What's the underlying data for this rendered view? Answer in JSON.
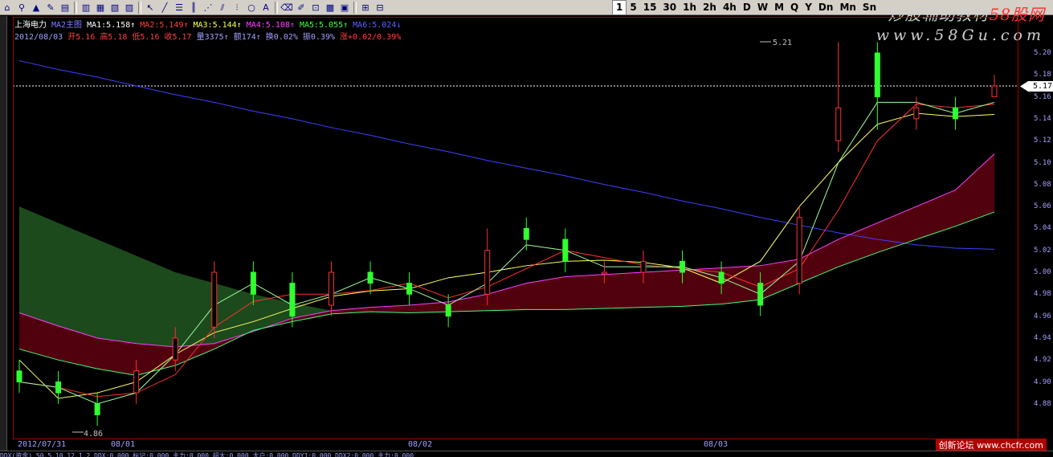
{
  "toolbar": {
    "icons": [
      "home-icon",
      "search-icon",
      "alarm-icon",
      "draw-icon",
      "layout-1-icon",
      "layout-2-icon",
      "layout-3-icon",
      "layout-4-icon",
      "layout-5-icon",
      "cursor-icon",
      "line-tool-icon",
      "text-tool-icon",
      "bar-tool-icon",
      "fan-tool-icon",
      "channel-tool-icon",
      "cycle-tool-icon",
      "shape-tool-icon",
      "text-label-icon",
      "erase-icon",
      "brush-icon",
      "lock-icon",
      "color-icon",
      "save-icon",
      "indicator-icon",
      "grid-icon"
    ],
    "periods": [
      "1",
      "5",
      "15",
      "30",
      "1h",
      "2h",
      "4h",
      "D",
      "W",
      "M",
      "Q",
      "Y",
      "Dn",
      "Mn",
      "Sn"
    ],
    "active_period": "1"
  },
  "watermark": {
    "line1_a": "炒股辅助教材",
    "line1_b": "58股网",
    "line2": "www.58Gu.com"
  },
  "info_line1": [
    {
      "text": "上海电力",
      "color": "#ffffff"
    },
    {
      "text": "MA2主图",
      "color": "#7f7fff"
    },
    {
      "text": "MA1:5.158↑",
      "color": "#ffffff"
    },
    {
      "text": "MA2:5.149↑",
      "color": "#ff4040"
    },
    {
      "text": "MA3:5.144↑",
      "color": "#ffff40"
    },
    {
      "text": "MA4:5.108↑",
      "color": "#ff40ff"
    },
    {
      "text": "MA5:5.055↑",
      "color": "#40ff40"
    },
    {
      "text": "MA6:5.024↓",
      "color": "#6060ff"
    }
  ],
  "info_line2": [
    {
      "text": "2012/08/03",
      "color": "#a0a0ff"
    },
    {
      "text": "开5.16",
      "color": "#ff4040"
    },
    {
      "text": "高5.18",
      "color": "#ff4040"
    },
    {
      "text": "低5.16",
      "color": "#ff4040"
    },
    {
      "text": "收5.17",
      "color": "#ff4040"
    },
    {
      "text": "量3375↑",
      "color": "#a0a0ff"
    },
    {
      "text": "额174↑",
      "color": "#a0a0ff"
    },
    {
      "text": "换0.02%",
      "color": "#a0a0ff"
    },
    {
      "text": "振0.39%",
      "color": "#a0a0ff"
    },
    {
      "text": "涨+0.02/0.39%",
      "color": "#ff4040"
    }
  ],
  "y_axis": [
    "5.20",
    "5.18",
    "5.16",
    "5.14",
    "5.12",
    "5.10",
    "5.08",
    "5.06",
    "5.04",
    "5.02",
    "5.00",
    "4.98",
    "4.96",
    "4.94",
    "4.92",
    "4.90",
    "4.88"
  ],
  "current_price": "5.17",
  "annotations": {
    "high": "5.21",
    "low": "4.86"
  },
  "dates": [
    "2012/07/31",
    "08/01",
    "08/02",
    "08/03"
  ],
  "bottom_text": "DDX(资金) 50.5.10.12.1.2  DDX:0.000  标记:0.000  主力:0.000  超大:0.000  大户:0.000  DDY1:0.000  DDX2:0.000  主力:0.000",
  "credit": "创新论坛 www.chcfr.com",
  "colors": {
    "up": "#ff3030",
    "down": "#30ff30",
    "ma1": "#ffffff",
    "ma2": "#ff3030",
    "ma3": "#ffff60",
    "ma4": "#ff40ff",
    "ma5": "#40ff80",
    "ma6": "#4040ff"
  },
  "chart_data": {
    "type": "candlestick",
    "title": "上海电力",
    "ylim": [
      4.86,
      5.21
    ],
    "series": [
      {
        "name": "MA6",
        "values": [
          5.193,
          5.185,
          5.178,
          5.17,
          5.162,
          5.155,
          5.147,
          5.14,
          5.132,
          5.125,
          5.117,
          5.11,
          5.102,
          5.095,
          5.088,
          5.08,
          5.073,
          5.065,
          5.058,
          5.05,
          5.043,
          5.036,
          5.03,
          5.025,
          5.022,
          5.021
        ]
      },
      {
        "name": "MA4",
        "values": [
          4.963,
          4.951,
          4.94,
          4.935,
          4.932,
          4.935,
          4.946,
          4.958,
          4.965,
          4.968,
          4.97,
          4.973,
          4.98,
          4.99,
          4.996,
          4.998,
          5.0,
          5.002,
          5.004,
          5.006,
          5.012,
          5.03,
          5.045,
          5.06,
          5.075,
          5.108
        ]
      },
      {
        "name": "MA5",
        "values": [
          4.93,
          4.92,
          4.912,
          4.906,
          4.915,
          4.93,
          4.947,
          4.955,
          4.962,
          4.964,
          4.963,
          4.964,
          4.965,
          4.966,
          4.966,
          4.967,
          4.968,
          4.969,
          4.971,
          4.975,
          4.99,
          5.005,
          5.018,
          5.03,
          5.042,
          5.055
        ]
      },
      {
        "name": "MA3",
        "values": [
          4.92,
          4.885,
          4.89,
          4.9,
          4.925,
          4.945,
          4.955,
          4.967,
          4.978,
          4.983,
          4.985,
          4.995,
          5.0,
          5.006,
          5.01,
          5.011,
          5.009,
          5.004,
          4.99,
          5.01,
          5.06,
          5.1,
          5.135,
          5.145,
          5.142,
          5.144
        ]
      }
    ],
    "candles": [
      {
        "o": 4.91,
        "c": 4.9,
        "h": 4.92,
        "l": 4.89
      },
      {
        "o": 4.9,
        "c": 4.89,
        "h": 4.91,
        "l": 4.88
      },
      {
        "o": 4.88,
        "c": 4.87,
        "h": 4.89,
        "l": 4.86
      },
      {
        "o": 4.89,
        "c": 4.91,
        "h": 4.92,
        "l": 4.88
      },
      {
        "o": 4.92,
        "c": 4.94,
        "h": 4.95,
        "l": 4.91
      },
      {
        "o": 4.95,
        "c": 5.0,
        "h": 5.01,
        "l": 4.94
      },
      {
        "o": 5.0,
        "c": 4.98,
        "h": 5.01,
        "l": 4.97
      },
      {
        "o": 4.99,
        "c": 4.96,
        "h": 5.0,
        "l": 4.95
      },
      {
        "o": 4.97,
        "c": 5.0,
        "h": 5.01,
        "l": 4.96
      },
      {
        "o": 5.0,
        "c": 4.99,
        "h": 5.01,
        "l": 4.98
      },
      {
        "o": 4.99,
        "c": 4.98,
        "h": 5.0,
        "l": 4.97
      },
      {
        "o": 4.97,
        "c": 4.96,
        "h": 4.98,
        "l": 4.95
      },
      {
        "o": 4.98,
        "c": 5.02,
        "h": 5.04,
        "l": 4.97
      },
      {
        "o": 5.04,
        "c": 5.03,
        "h": 5.05,
        "l": 5.02
      },
      {
        "o": 5.03,
        "c": 5.01,
        "h": 5.04,
        "l": 5.0
      },
      {
        "o": 5.0,
        "c": 5.0,
        "h": 5.01,
        "l": 4.99
      },
      {
        "o": 5.0,
        "c": 5.01,
        "h": 5.02,
        "l": 4.99
      },
      {
        "o": 5.01,
        "c": 5.0,
        "h": 5.02,
        "l": 4.99
      },
      {
        "o": 5.0,
        "c": 4.99,
        "h": 5.01,
        "l": 4.98
      },
      {
        "o": 4.99,
        "c": 4.97,
        "h": 5.0,
        "l": 4.96
      },
      {
        "o": 4.99,
        "c": 5.05,
        "h": 5.06,
        "l": 4.98
      },
      {
        "o": 5.12,
        "c": 5.15,
        "h": 5.21,
        "l": 5.11
      },
      {
        "o": 5.2,
        "c": 5.16,
        "h": 5.21,
        "l": 5.13
      },
      {
        "o": 5.14,
        "c": 5.15,
        "h": 5.16,
        "l": 5.13
      },
      {
        "o": 5.15,
        "c": 5.14,
        "h": 5.16,
        "l": 5.13
      },
      {
        "o": 5.16,
        "c": 5.17,
        "h": 5.18,
        "l": 5.16
      }
    ]
  }
}
